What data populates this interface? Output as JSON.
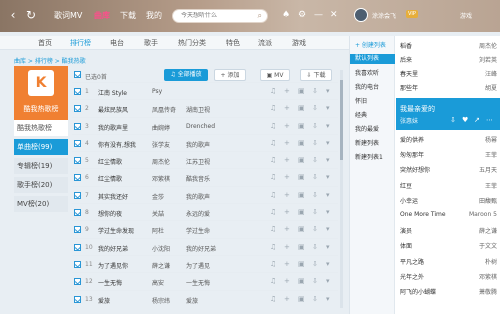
{
  "topbar": {
    "nav": [
      "歌词MV",
      "曲库",
      "下载",
      "我的"
    ],
    "active": "曲库",
    "search_placeholder": "今天想听什么",
    "user": "涂涂会飞",
    "vip": "VIP",
    "game": "游戏"
  },
  "categories": [
    "首页",
    "排行榜",
    "电台",
    "歌手",
    "热门分类",
    "特色",
    "流派",
    "游戏"
  ],
  "breadcrumb": "曲库 > 排行榜 > 酷我热歌",
  "left": {
    "album_caption": "酷我热歌榜",
    "head": "酷我热歌榜",
    "items": [
      "单曲榜(99)",
      "专辑榜(19)",
      "歌手榜(20)",
      "MV榜(20)"
    ],
    "active_index": 0
  },
  "toolbar": {
    "selected_label": "已选0首",
    "play_all": "全部播放",
    "add": "添加",
    "mv": "MV",
    "download": "下载"
  },
  "songs": [
    {
      "idx": "1",
      "title": "江南 Style",
      "artist": "Psy",
      "album": ""
    },
    {
      "idx": "2",
      "title": "最炫民族风",
      "artist": "凤凰传奇",
      "album": "湖南卫视"
    },
    {
      "idx": "3",
      "title": "我的歌声里",
      "artist": "曲婉婷",
      "album": "Drenched"
    },
    {
      "idx": "4",
      "title": "你有没有,想我",
      "artist": "张学友",
      "album": "我的歌声"
    },
    {
      "idx": "5",
      "title": "红尘情歌",
      "artist": "周杰伦",
      "album": "江苏卫视"
    },
    {
      "idx": "6",
      "title": "红尘情歌",
      "artist": "邓紫棋",
      "album": "酷我音乐"
    },
    {
      "idx": "7",
      "title": "其实我还好",
      "artist": "金莎",
      "album": "我的歌声"
    },
    {
      "idx": "8",
      "title": "想你的夜",
      "artist": "关喆",
      "album": "永远的爱"
    },
    {
      "idx": "9",
      "title": "学过生命发现",
      "artist": "阿杜",
      "album": "学过生命"
    },
    {
      "idx": "10",
      "title": "我的好兄弟",
      "artist": "小沈阳",
      "album": "我的好兄弟"
    },
    {
      "idx": "11",
      "title": "为了遇见你",
      "artist": "薛之谦",
      "album": "为了遇见"
    },
    {
      "idx": "12",
      "title": "一生无悔",
      "artist": "高安",
      "album": "一生无悔"
    },
    {
      "idx": "13",
      "title": "爱旅",
      "artist": "杨宗纬",
      "album": "爱旅"
    }
  ],
  "right": {
    "sidebar": [
      {
        "label": "+ 创建列表",
        "style": "link"
      },
      {
        "label": "默认列表",
        "style": "sel"
      },
      {
        "label": "我喜欢听",
        "style": "plain"
      },
      {
        "label": "我的电台",
        "style": "plain"
      },
      {
        "label": "怀旧",
        "style": "plain"
      },
      {
        "label": "经典",
        "style": "plain"
      },
      {
        "label": "我的最爱",
        "style": "plain"
      },
      {
        "label": "新建列表",
        "style": "plain"
      },
      {
        "label": "新建列表1",
        "style": "plain"
      }
    ],
    "list": [
      {
        "title": "稻香",
        "artist": "周杰伦"
      },
      {
        "title": "后来",
        "artist": "刘若英"
      },
      {
        "title": "春天里",
        "artist": "汪峰"
      },
      {
        "title": "那些年",
        "artist": "胡夏"
      },
      {
        "title": "爱的供养",
        "artist": "杨幂"
      },
      {
        "title": "匆匆那年",
        "artist": "王菲"
      },
      {
        "title": "突然好想你",
        "artist": "五月天"
      },
      {
        "title": "红豆",
        "artist": "王菲"
      },
      {
        "title": "小幸运",
        "artist": "田馥甄"
      },
      {
        "title": "One More Time",
        "artist": "Maroon 5"
      },
      {
        "title": "演员",
        "artist": "薛之谦"
      },
      {
        "title": "体面",
        "artist": "于文文"
      },
      {
        "title": "平凡之路",
        "artist": "朴树"
      },
      {
        "title": "光年之外",
        "artist": "邓紫棋"
      },
      {
        "title": "阿飞的小蝴蝶",
        "artist": "萧敬腾"
      }
    ],
    "now_playing": {
      "title": "我最亲爱的",
      "artist": "张惠妹"
    }
  }
}
